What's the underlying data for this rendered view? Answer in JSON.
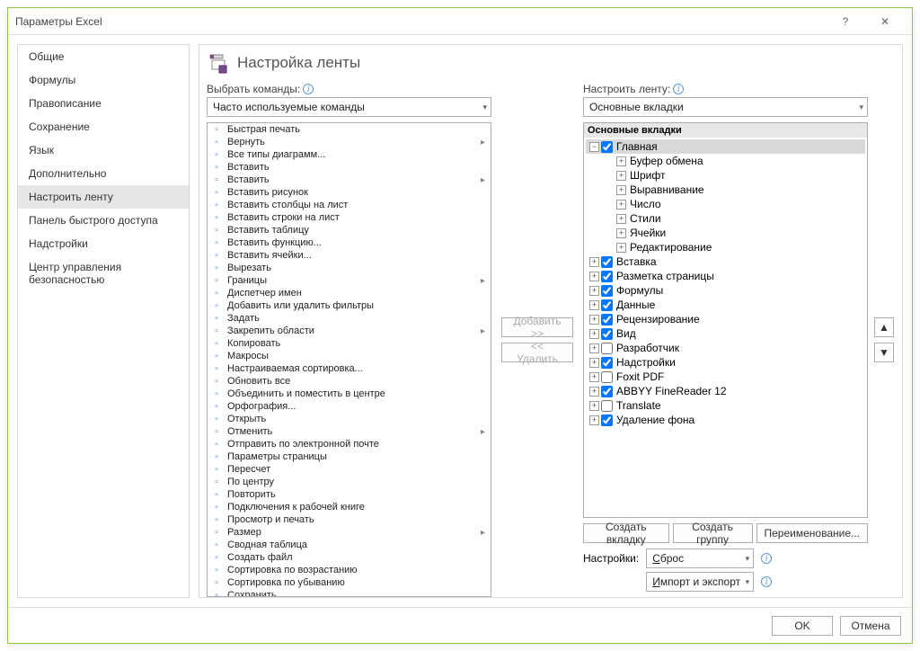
{
  "title": "Параметры Excel",
  "sidebar": {
    "items": [
      {
        "label": "Общие"
      },
      {
        "label": "Формулы"
      },
      {
        "label": "Правописание"
      },
      {
        "label": "Сохранение"
      },
      {
        "label": "Язык"
      },
      {
        "label": "Дополнительно"
      },
      {
        "label": "Настроить ленту"
      },
      {
        "label": "Панель быстрого доступа"
      },
      {
        "label": "Надстройки"
      },
      {
        "label": "Центр управления безопасностью"
      }
    ],
    "active": 6
  },
  "page": {
    "heading": "Настройка ленты",
    "left_label": "Выбрать команды:",
    "left_combo": "Часто используемые команды",
    "right_label": "Настроить ленту:",
    "right_combo": "Основные вкладки"
  },
  "commands": [
    {
      "label": "Быстрая печать"
    },
    {
      "label": "Вернуть",
      "expand": true
    },
    {
      "label": "Все типы диаграмм..."
    },
    {
      "label": "Вставить"
    },
    {
      "label": "Вставить",
      "expand": true
    },
    {
      "label": "Вставить рисунок"
    },
    {
      "label": "Вставить столбцы на лист"
    },
    {
      "label": "Вставить строки на лист"
    },
    {
      "label": "Вставить таблицу"
    },
    {
      "label": "Вставить функцию..."
    },
    {
      "label": "Вставить ячейки..."
    },
    {
      "label": "Вырезать"
    },
    {
      "label": "Границы",
      "expand": true
    },
    {
      "label": "Диспетчер имен"
    },
    {
      "label": "Добавить или удалить фильтры"
    },
    {
      "label": "Задать"
    },
    {
      "label": "Закрепить области",
      "expand": true
    },
    {
      "label": "Копировать"
    },
    {
      "label": "Макросы"
    },
    {
      "label": "Настраиваемая сортировка..."
    },
    {
      "label": "Обновить все"
    },
    {
      "label": "Объединить и поместить в центре"
    },
    {
      "label": "Орфография..."
    },
    {
      "label": "Открыть"
    },
    {
      "label": "Отменить",
      "expand": true
    },
    {
      "label": "Отправить по электронной почте"
    },
    {
      "label": "Параметры страницы"
    },
    {
      "label": "Пересчет"
    },
    {
      "label": "По центру"
    },
    {
      "label": "Повторить"
    },
    {
      "label": "Подключения к рабочей книге"
    },
    {
      "label": "Просмотр и печать"
    },
    {
      "label": "Размер",
      "expand": true
    },
    {
      "label": "Сводная таблица"
    },
    {
      "label": "Создать файл"
    },
    {
      "label": "Сортировка по возрастанию"
    },
    {
      "label": "Сортировка по убыванию"
    },
    {
      "label": "Сохранить"
    }
  ],
  "tree": {
    "header": "Основные вкладки",
    "items": [
      {
        "label": "Главная",
        "checked": true,
        "expanded": true,
        "level": 0,
        "children": true,
        "selected": true
      },
      {
        "label": "Буфер обмена",
        "level": 1,
        "expandable": true
      },
      {
        "label": "Шрифт",
        "level": 1,
        "expandable": true
      },
      {
        "label": "Выравнивание",
        "level": 1,
        "expandable": true
      },
      {
        "label": "Число",
        "level": 1,
        "expandable": true
      },
      {
        "label": "Стили",
        "level": 1,
        "expandable": true
      },
      {
        "label": "Ячейки",
        "level": 1,
        "expandable": true
      },
      {
        "label": "Редактирование",
        "level": 1,
        "expandable": true
      },
      {
        "label": "Вставка",
        "checked": true,
        "level": 0,
        "children": true
      },
      {
        "label": "Разметка страницы",
        "checked": true,
        "level": 0,
        "children": true
      },
      {
        "label": "Формулы",
        "checked": true,
        "level": 0,
        "children": true
      },
      {
        "label": "Данные",
        "checked": true,
        "level": 0,
        "children": true
      },
      {
        "label": "Рецензирование",
        "checked": true,
        "level": 0,
        "children": true
      },
      {
        "label": "Вид",
        "checked": true,
        "level": 0,
        "children": true
      },
      {
        "label": "Разработчик",
        "checked": false,
        "level": 0,
        "children": true
      },
      {
        "label": "Надстройки",
        "checked": true,
        "level": 0,
        "children": true
      },
      {
        "label": "Foxit PDF",
        "checked": false,
        "level": 0,
        "children": true
      },
      {
        "label": "ABBYY FineReader 12",
        "checked": true,
        "level": 0,
        "children": true
      },
      {
        "label": "Translate",
        "checked": false,
        "level": 0,
        "children": true
      },
      {
        "label": "Удаление фона",
        "checked": true,
        "level": 0,
        "children": true
      }
    ]
  },
  "buttons": {
    "add": "Добавить >>",
    "remove": "<< Удалить",
    "new_tab": "Создать вкладку",
    "new_group": "Создать группу",
    "rename": "Переименование...",
    "customize_label": "Настройки:",
    "reset": "Сброс",
    "import_export": "Импорт и экспорт",
    "ok": "OK",
    "cancel": "Отмена"
  }
}
